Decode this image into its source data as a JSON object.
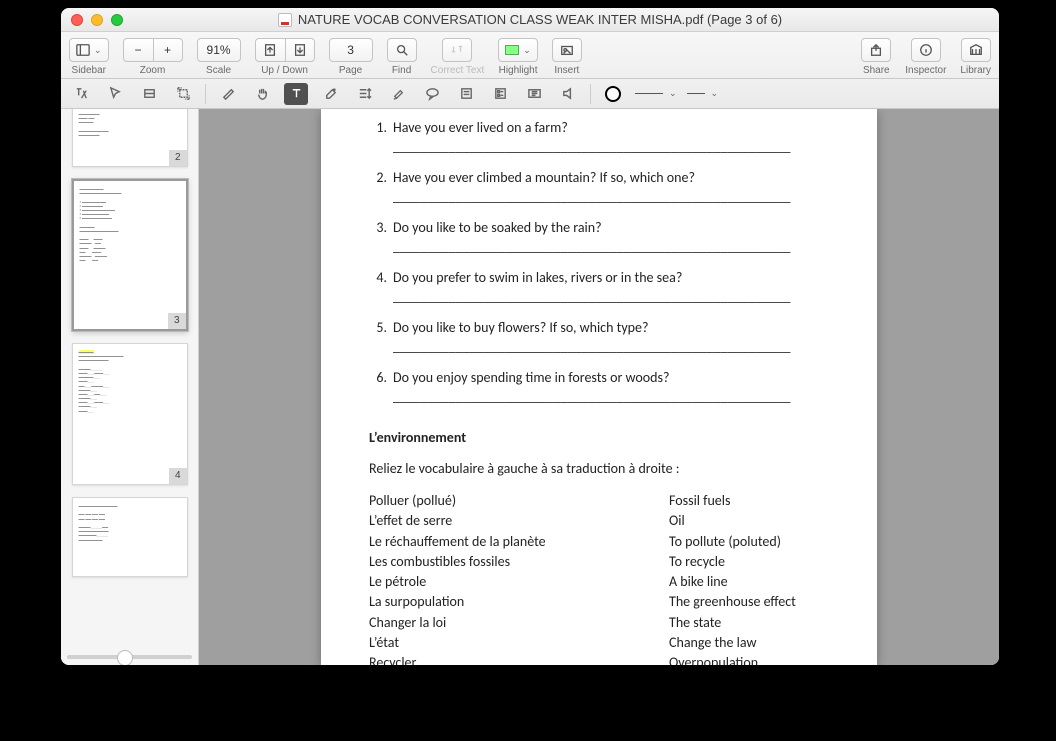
{
  "window": {
    "title": "NATURE VOCAB CONVERSATION CLASS WEAK INTER MISHA.pdf (Page 3 of 6)"
  },
  "toolbar": {
    "sidebar": "Sidebar",
    "zoom": "Zoom",
    "zoom_pct": "91%",
    "scale": "Scale",
    "updown": "Up / Down",
    "page": "Page",
    "page_num": "3",
    "find": "Find",
    "correct": "Correct Text",
    "highlight": "Highlight",
    "insert": "Insert",
    "share": "Share",
    "inspector": "Inspector",
    "library": "Library"
  },
  "thumbs": {
    "p2": "2",
    "p3": "3",
    "p4": "4"
  },
  "doc": {
    "questions": [
      "Have you ever lived on a farm?",
      "Have you ever climbed a mountain? If so, which one?",
      "Do you like to be soaked by the rain?",
      "Do you prefer to swim in lakes, rivers or in the sea?",
      "Do you like to buy flowers? If so, which type?",
      "Do you enjoy spending time in forests or woods?"
    ],
    "blank": "_________________________________________________________",
    "section": "L’environnement",
    "instruction": "Reliez le vocabulaire à gauche à sa traduction à droite :",
    "left": [
      "Polluer (pollué)",
      "L’effet de serre",
      "Le réchauffement de la planète",
      "Les combustibles fossiles",
      "Le pétrole",
      "La surpopulation",
      "Changer la loi",
      "L’état",
      "Recycler"
    ],
    "right": [
      "Fossil fuels",
      "Oil",
      "To pollute (poluted)",
      "To recycle",
      "A bike line",
      "The greenhouse effect",
      "The state",
      "Change the law",
      "Overpopulation"
    ]
  }
}
